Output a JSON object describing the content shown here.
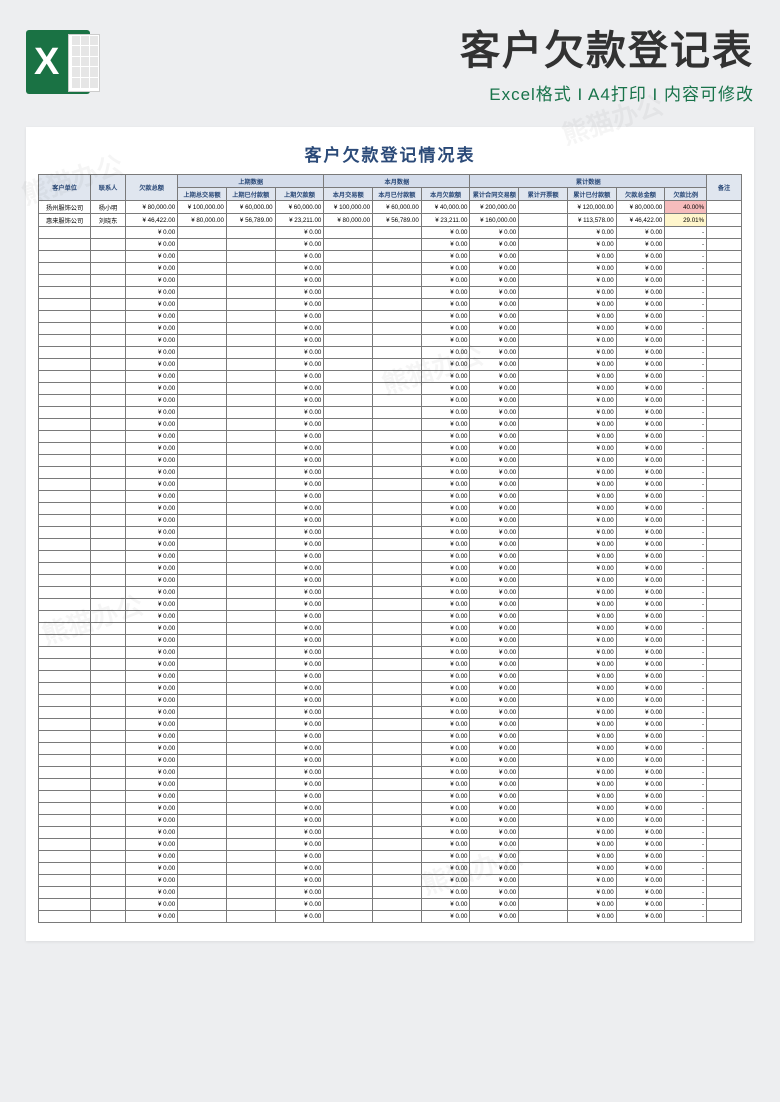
{
  "watermark": "熊猫办公",
  "top": {
    "excel_letter": "X",
    "main_title": "客户欠款登记表",
    "sub_title": "Excel格式 I A4打印 I 内容可修改"
  },
  "sheet": {
    "title": "客户欠款登记情况表",
    "headers": {
      "client": "客户单位",
      "contact": "联系人",
      "total_owed": "欠款总额",
      "group_prev": "上期数据",
      "group_month": "本月数据",
      "group_cum": "累计数据",
      "remark": "备注",
      "prev_trade": "上期总交易额",
      "prev_paid": "上期已付款额",
      "prev_owed": "上期欠款额",
      "month_trade": "本月交易额",
      "month_paid": "本月已付款额",
      "month_owed": "本月欠款额",
      "cum_contract": "累计合同交易额",
      "cum_invoice": "累计开票额",
      "cum_paid": "累计已付款额",
      "cum_owed_amt": "欠款总金额",
      "owed_ratio": "欠款比例"
    },
    "rows": [
      {
        "client": "扬州服饰公司",
        "contact": "杨小明",
        "total_owed": "¥ 80,000.00",
        "prev_trade": "¥ 100,000.00",
        "prev_paid": "¥ 60,000.00",
        "prev_owed": "¥ 60,000.00",
        "month_trade": "¥ 100,000.00",
        "month_paid": "¥ 60,000.00",
        "month_owed": "¥ 40,000.00",
        "cum_contract": "¥ 200,000.00",
        "cum_invoice": "",
        "cum_paid": "¥ 120,000.00",
        "cum_owed_amt": "¥ 80,000.00",
        "owed_ratio": "40.00%",
        "ratio_class": "red",
        "remark": ""
      },
      {
        "client": "惠来服饰公司",
        "contact": "刘晓东",
        "total_owed": "¥ 46,422.00",
        "prev_trade": "¥ 80,000.00",
        "prev_paid": "¥ 56,789.00",
        "prev_owed": "¥ 23,211.00",
        "month_trade": "¥ 80,000.00",
        "month_paid": "¥ 56,789.00",
        "month_owed": "¥ 23,211.00",
        "cum_contract": "¥ 160,000.00",
        "cum_invoice": "",
        "cum_paid": "¥ 113,578.00",
        "cum_owed_amt": "¥ 46,422.00",
        "owed_ratio": "29.01%",
        "ratio_class": "yellow",
        "remark": ""
      }
    ],
    "empty_row": {
      "total_owed": "¥ 0.00",
      "prev_owed": "¥ 0.00",
      "month_owed": "¥ 0.00",
      "cum_contract": "¥ 0.00",
      "cum_paid": "¥ 0.00",
      "cum_owed_amt": "¥ 0.00",
      "owed_ratio": "-"
    },
    "empty_row_count": 58
  }
}
